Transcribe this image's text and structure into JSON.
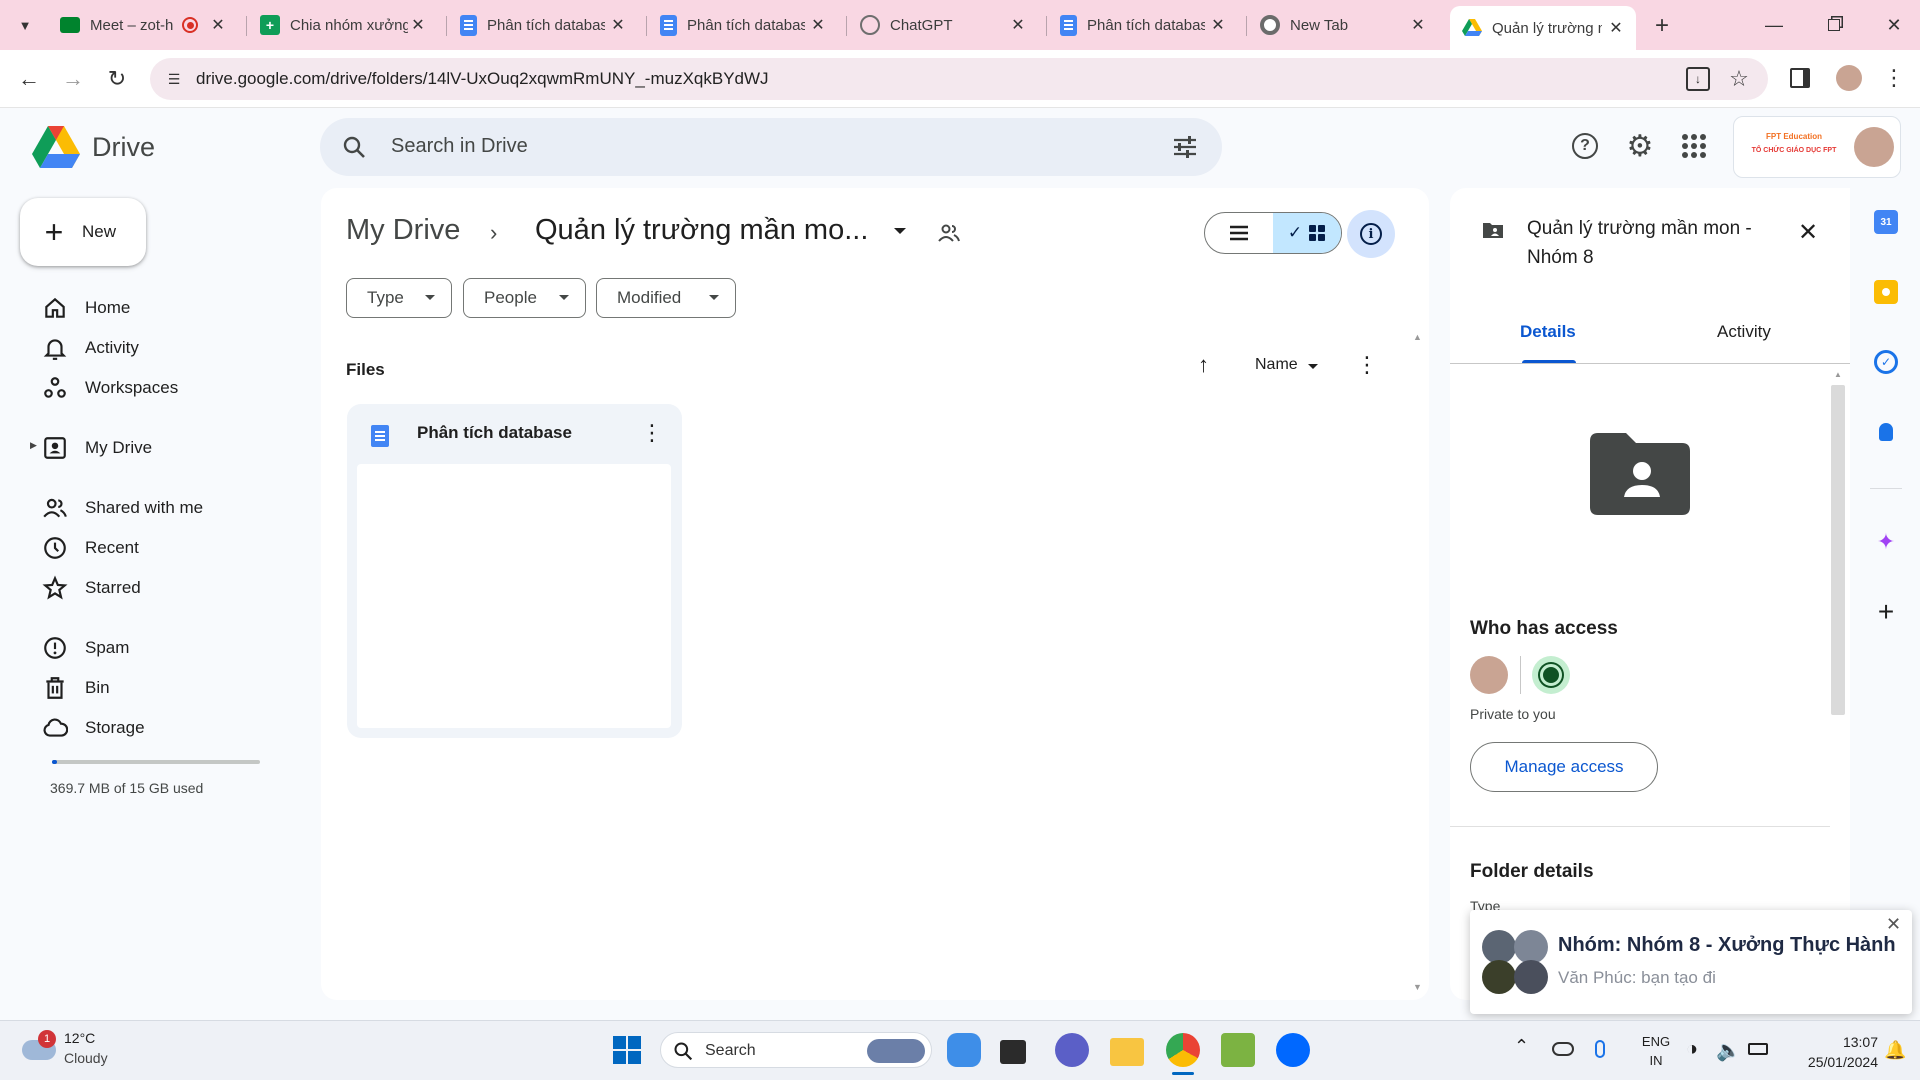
{
  "browser": {
    "tabs": [
      {
        "label": "Meet – zot-h",
        "icon": "google-meet-icon",
        "recording": true
      },
      {
        "label": "Chia nhóm xưởng",
        "icon": "google-sheets-icon"
      },
      {
        "label": "Phân tích database",
        "icon": "google-docs-icon"
      },
      {
        "label": "Phân tích database",
        "icon": "google-docs-icon"
      },
      {
        "label": "ChatGPT",
        "icon": "chatgpt-icon"
      },
      {
        "label": "Phân tích database",
        "icon": "google-docs-icon"
      },
      {
        "label": "New Tab",
        "icon": "chrome-icon"
      },
      {
        "label": "Quản lý trường m",
        "icon": "google-drive-icon",
        "active": true
      }
    ],
    "url": "drive.google.com/drive/folders/14lV-UxOuq2xqwmRmUNY_-muzXqkBYdWJ"
  },
  "drive": {
    "logo_text": "Drive",
    "search_placeholder": "Search in Drive",
    "new_label": "New",
    "account_brand_line1": "FPT Education",
    "account_brand_line2": "TỔ CHỨC GIÁO DỤC FPT",
    "nav": [
      {
        "label": "Home",
        "icon": "home-icon"
      },
      {
        "label": "Activity",
        "icon": "bell-icon"
      },
      {
        "label": "Workspaces",
        "icon": "workspaces-icon"
      },
      {
        "label": "My Drive",
        "icon": "my-drive-icon"
      },
      {
        "label": "Shared with me",
        "icon": "shared-icon"
      },
      {
        "label": "Recent",
        "icon": "clock-icon"
      },
      {
        "label": "Starred",
        "icon": "star-icon"
      },
      {
        "label": "Spam",
        "icon": "spam-icon"
      },
      {
        "label": "Bin",
        "icon": "bin-icon"
      },
      {
        "label": "Storage",
        "icon": "cloud-icon"
      }
    ],
    "storage_text": "369.7 MB of 15 GB used",
    "storage_fraction": 0.024
  },
  "main": {
    "breadcrumb_root": "My Drive",
    "breadcrumb_current": "Quản lý trường mần mo...",
    "filters": [
      "Type",
      "People",
      "Modified"
    ],
    "section_label": "Files",
    "sort_label": "Name",
    "files": [
      {
        "name": "Phân tích database",
        "icon": "google-docs-icon"
      }
    ]
  },
  "details": {
    "title": "Quản lý trường mần mon - Nhóm 8",
    "tabs": [
      "Details",
      "Activity"
    ],
    "who_has_access": "Who has access",
    "privacy": "Private to you",
    "manage_access": "Manage access",
    "folder_details": "Folder details",
    "type_label": "Type"
  },
  "notification": {
    "title": "Nhóm: Nhóm 8 - Xưởng Thực Hành",
    "message": "Văn Phúc: bạn tạo đi"
  },
  "taskbar": {
    "weather_temp": "12°C",
    "weather_desc": "Cloudy",
    "weather_badge": "1",
    "search_label": "Search",
    "lang1": "ENG",
    "lang2": "IN",
    "time": "13:07",
    "date": "25/01/2024"
  },
  "colors": {
    "tabbar": "#f9d7e3",
    "accent": "#0b57d0",
    "selected_toggle": "#c2e7ff"
  }
}
